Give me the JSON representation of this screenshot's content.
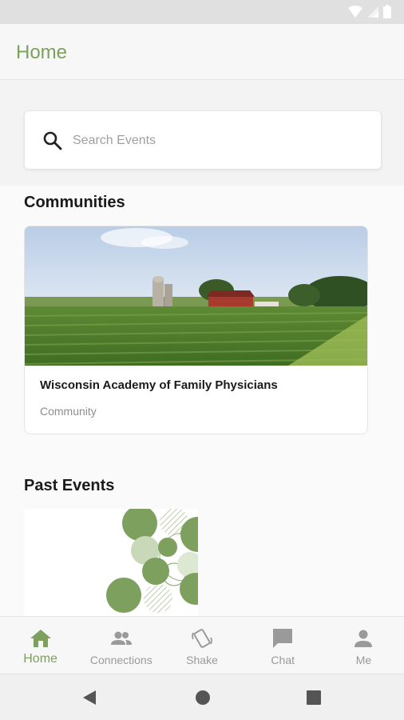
{
  "app": {
    "title": "Home"
  },
  "search": {
    "placeholder": "Search Events",
    "value": ""
  },
  "sections": {
    "communities_title": "Communities",
    "past_events_title": "Past Events"
  },
  "communities": [
    {
      "name": "Wisconsin Academy of Family Physicians",
      "type": "Community"
    }
  ],
  "nav": {
    "items": [
      {
        "label": "Home",
        "icon": "home-icon",
        "active": true
      },
      {
        "label": "Connections",
        "icon": "people-icon",
        "active": false
      },
      {
        "label": "Shake",
        "icon": "shake-phone-icon",
        "active": false
      },
      {
        "label": "Chat",
        "icon": "chat-bubble-icon",
        "active": false
      },
      {
        "label": "Me",
        "icon": "person-icon",
        "active": false
      }
    ]
  },
  "colors": {
    "accent": "#7ea05e",
    "inactive": "#9a9a9a"
  }
}
